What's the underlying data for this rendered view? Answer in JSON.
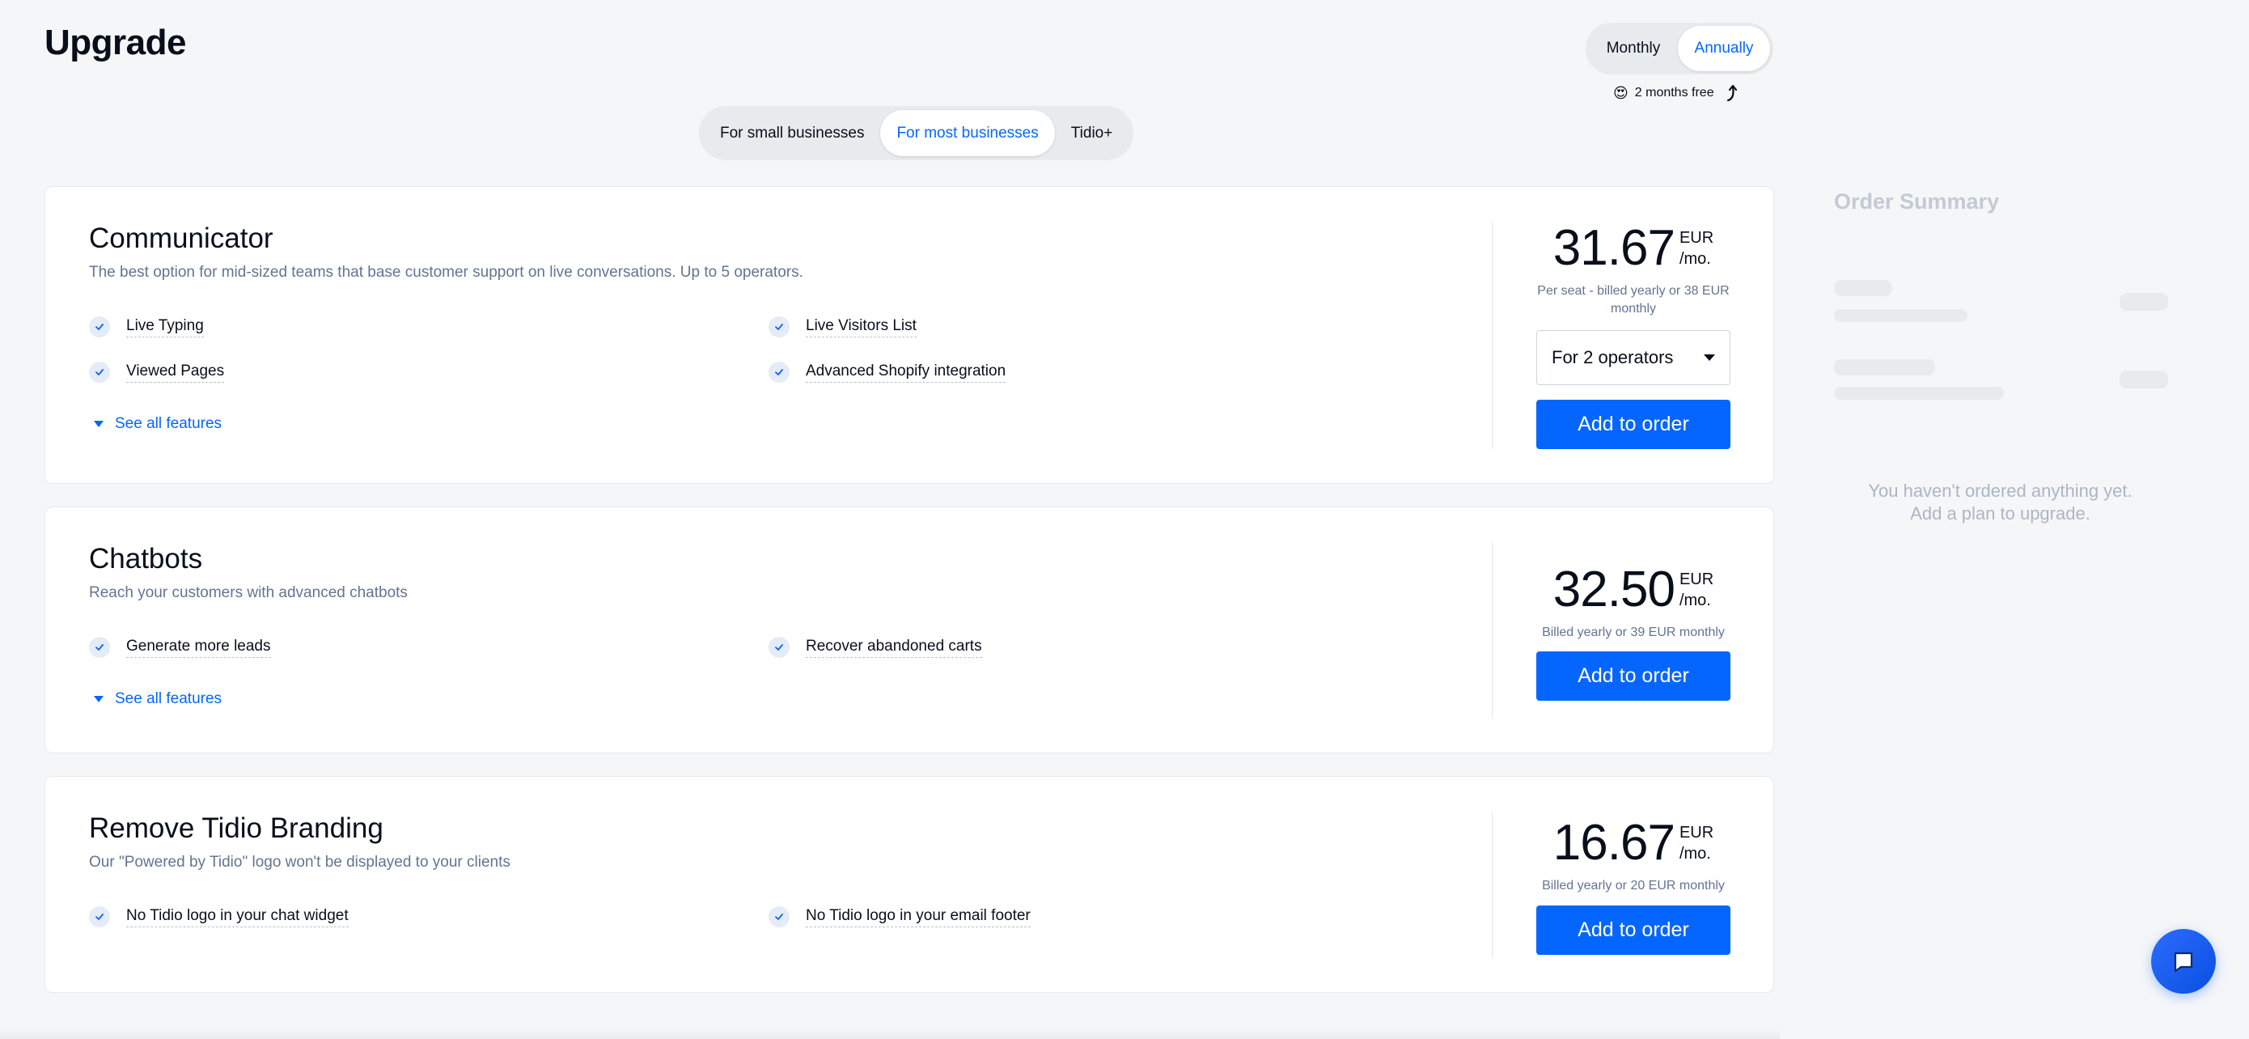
{
  "page": {
    "title": "Upgrade"
  },
  "billing": {
    "monthly": "Monthly",
    "annually": "Annually",
    "selected": "Annually",
    "promo_emoji": "😍",
    "promo_text": "2 months free"
  },
  "segments": {
    "tabs": [
      "For small businesses",
      "For most businesses",
      "Tidio+"
    ],
    "selected": "For most businesses"
  },
  "plans": [
    {
      "name": "Communicator",
      "description": "The best option for mid-sized teams that base customer support on live conversations. Up to 5 operators.",
      "features": [
        "Live Typing",
        "Live Visitors List",
        "Viewed Pages",
        "Advanced Shopify integration"
      ],
      "see_all": "See all features",
      "price": "31.67",
      "currency": "EUR",
      "per": "/mo.",
      "note_line1": "Per seat - billed yearly or 38 EUR",
      "note_line2": "monthly",
      "select_value": "For 2 operators",
      "cta": "Add to order"
    },
    {
      "name": "Chatbots",
      "description": "Reach your customers with advanced chatbots",
      "features": [
        "Generate more leads",
        "Recover abandoned carts"
      ],
      "see_all": "See all features",
      "price": "32.50",
      "currency": "EUR",
      "per": "/mo.",
      "note_line1": "Billed yearly or 39 EUR monthly",
      "cta": "Add to order"
    },
    {
      "name": "Remove Tidio Branding",
      "description": "Our \"Powered by Tidio\" logo won't be displayed to your clients",
      "features": [
        "No Tidio logo in your chat widget",
        "No Tidio logo in your email footer"
      ],
      "price": "16.67",
      "currency": "EUR",
      "per": "/mo.",
      "note_line1": "Billed yearly or 20 EUR monthly",
      "cta": "Add to order"
    }
  ],
  "summary": {
    "title": "Order Summary",
    "empty_line1": "You haven't ordered anything yet.",
    "empty_line2": "Add a plan to upgrade."
  },
  "colors": {
    "accent": "#0566ff",
    "text": "#080f1a",
    "muted": "#647491",
    "background": "#f5f6f8"
  }
}
